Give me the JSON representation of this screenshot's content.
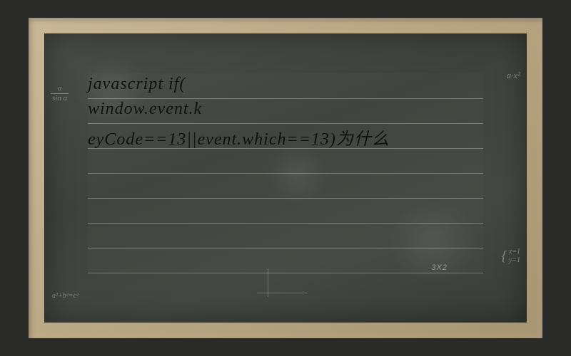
{
  "main_content": {
    "line1": "javascript if(",
    "line2": "window.event.k",
    "line3": "eyCode==13||event.which==13)为什么"
  },
  "decorations": {
    "formula_left_top_num": "a",
    "formula_left_top_den": "sin α",
    "formula_left_bottom": "a²+b²=c²",
    "formula_right_top": "a·x²",
    "formula_right_bottom_1": "x=1",
    "formula_right_bottom_2": "y=1",
    "bottom_label": "3X2"
  }
}
